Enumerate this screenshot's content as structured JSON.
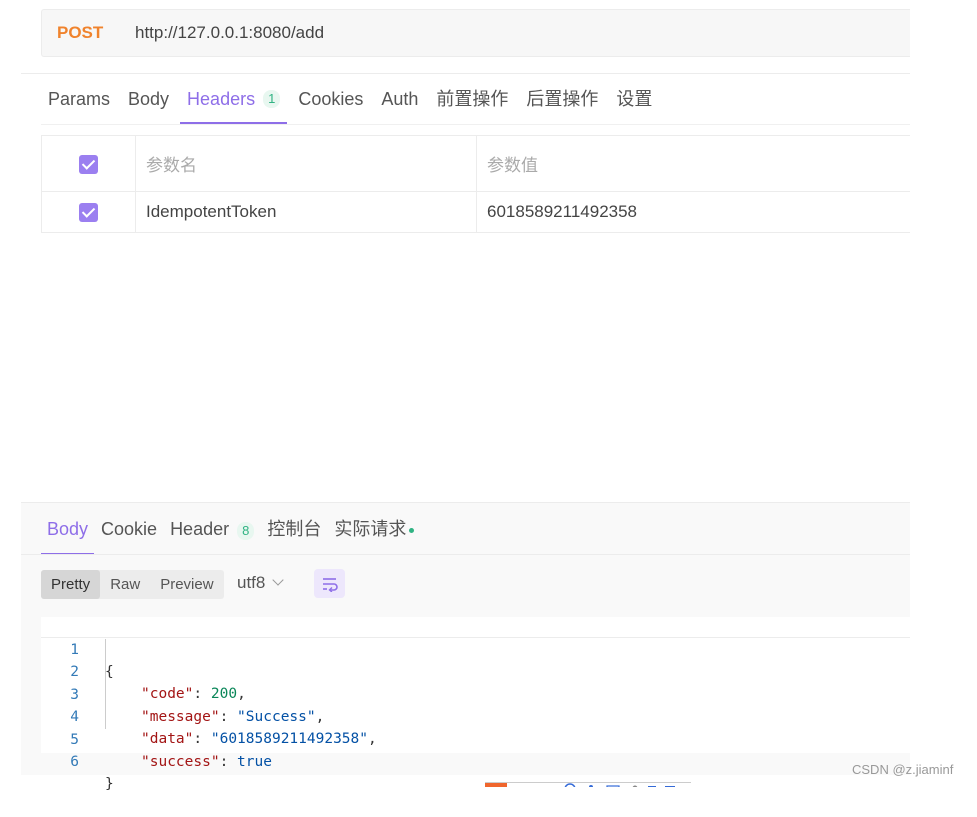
{
  "request": {
    "method": "POST",
    "url": "http://127.0.0.1:8080/add"
  },
  "request_tabs": [
    {
      "label": "Params"
    },
    {
      "label": "Body"
    },
    {
      "label": "Headers",
      "count": "1",
      "active": true
    },
    {
      "label": "Cookies"
    },
    {
      "label": "Auth"
    },
    {
      "label": "前置操作"
    },
    {
      "label": "后置操作"
    },
    {
      "label": "设置"
    }
  ],
  "headers_table": {
    "columns": [
      "参数名",
      "参数值"
    ],
    "rows": [
      {
        "checked": true,
        "name": "IdempotentToken",
        "value": "6018589211492358"
      }
    ]
  },
  "response": {
    "tabs": [
      {
        "label": "Body",
        "active": true
      },
      {
        "label": "Cookie"
      },
      {
        "label": "Header",
        "count": "8"
      },
      {
        "label": "控制台"
      },
      {
        "label": "实际请求",
        "status_dot": true
      }
    ],
    "modes": [
      "Pretty",
      "Raw",
      "Preview"
    ],
    "active_mode": "Pretty",
    "encoding": "utf8",
    "code_lines": [
      {
        "n": "1",
        "text": "{"
      },
      {
        "n": "2",
        "key": "\"code\"",
        "value": "200",
        "type": "n",
        "comma": true
      },
      {
        "n": "3",
        "key": "\"message\"",
        "value": "\"Success\"",
        "type": "s",
        "comma": true
      },
      {
        "n": "4",
        "key": "\"data\"",
        "value": "\"6018589211492358\"",
        "type": "s",
        "comma": true
      },
      {
        "n": "5",
        "key": "\"success\"",
        "value": "true",
        "type": "b",
        "comma": false
      },
      {
        "n": "6",
        "text": "}"
      }
    ]
  },
  "watermark": "CSDN @z.jiaminf",
  "colors": {
    "accent": "#8e6ee8",
    "method": "#f0832d",
    "badge": "#30b383"
  }
}
